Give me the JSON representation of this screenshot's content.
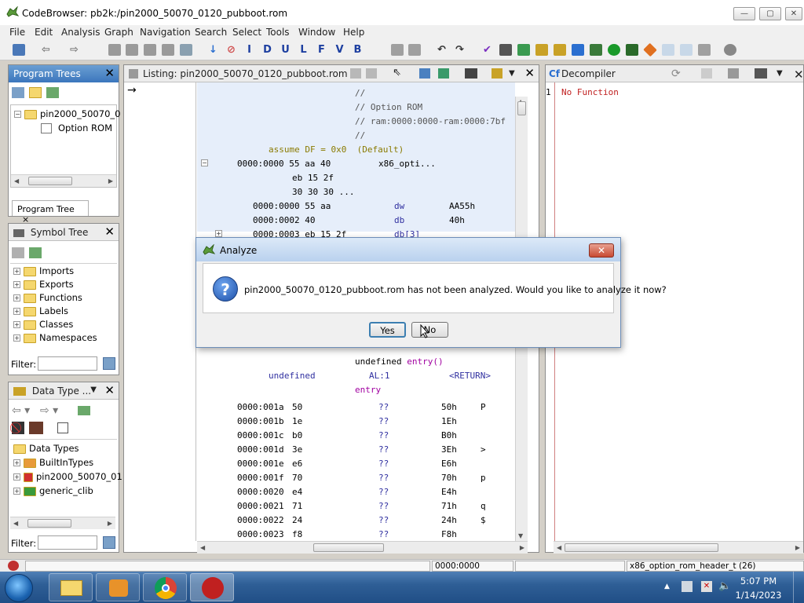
{
  "window": {
    "title": "CodeBrowser: pb2k:/pin2000_50070_0120_pubboot.rom",
    "min": "—",
    "max": "▢",
    "close": "✕"
  },
  "menu": [
    "File",
    "Edit",
    "Analysis",
    "Graph",
    "Navigation",
    "Search",
    "Select",
    "Tools",
    "Window",
    "Help"
  ],
  "toolbar": {
    "letters": [
      "I",
      "D",
      "U",
      "L",
      "F",
      "V",
      "B"
    ]
  },
  "program_trees": {
    "title": "Program Trees",
    "root": "pin2000_50070_0",
    "child": "Option ROM",
    "tab": "Program Tree",
    "tab_close": "×"
  },
  "symbol_tree": {
    "title": "Symbol Tree",
    "items": [
      "Imports",
      "Exports",
      "Functions",
      "Labels",
      "Classes",
      "Namespaces"
    ],
    "filter_label": "Filter:"
  },
  "data_type": {
    "title": "Data Type ...",
    "items": [
      "Data Types",
      "BuiltInTypes",
      "pin2000_50070_01",
      "generic_clib"
    ],
    "filter_label": "Filter:"
  },
  "listing": {
    "title": "Listing:  pin2000_50070_0120_pubboot.rom",
    "lines_top": [
      {
        "text": "//",
        "cls": "comment"
      },
      {
        "text": "// Option ROM",
        "cls": "comment"
      },
      {
        "text": "// ram:0000:0000-ram:0000:7bf",
        "cls": "comment"
      },
      {
        "text": "//",
        "cls": "comment"
      }
    ],
    "assume": "assume DF = 0x0  (Default)",
    "row0_addr": "0000:0000 55 aa 40",
    "row0_label": "x86_opti...",
    "row0_b2": "eb 15 2f",
    "row0_b3": "30 30 30 ...",
    "sub_rows": [
      {
        "addr": "0000:0000 55 aa",
        "mn": "dw",
        "op": "AA55h"
      },
      {
        "addr": "0000:0002 40",
        "mn": "db",
        "op": "40h"
      },
      {
        "addr": "0000:0003 eb 15 2f",
        "mn": "db[3]",
        "op": ""
      }
    ],
    "func_sig_pre": "undefined ",
    "func_sig_name": "entry()",
    "ret_type": "undefined",
    "ret_reg": "AL:1",
    "ret_ann": "<RETURN>",
    "entry_label": "entry",
    "data_rows": [
      {
        "a": "0000:001a",
        "b": "50",
        "q": "??",
        "v": "50h",
        "c": "P"
      },
      {
        "a": "0000:001b",
        "b": "1e",
        "q": "??",
        "v": "1Eh",
        "c": ""
      },
      {
        "a": "0000:001c",
        "b": "b0",
        "q": "??",
        "v": "B0h",
        "c": ""
      },
      {
        "a": "0000:001d",
        "b": "3e",
        "q": "??",
        "v": "3Eh",
        "c": ">"
      },
      {
        "a": "0000:001e",
        "b": "e6",
        "q": "??",
        "v": "E6h",
        "c": ""
      },
      {
        "a": "0000:001f",
        "b": "70",
        "q": "??",
        "v": "70h",
        "c": "p"
      },
      {
        "a": "0000:0020",
        "b": "e4",
        "q": "??",
        "v": "E4h",
        "c": ""
      },
      {
        "a": "0000:0021",
        "b": "71",
        "q": "??",
        "v": "71h",
        "c": "q"
      },
      {
        "a": "0000:0022",
        "b": "24",
        "q": "??",
        "v": "24h",
        "c": "$"
      },
      {
        "a": "0000:0023",
        "b": "f8",
        "q": "??",
        "v": "F8h",
        "c": ""
      }
    ]
  },
  "decompiler": {
    "title": "Decompiler",
    "line_no": "1",
    "text": "No Function"
  },
  "dialog": {
    "title": "Analyze",
    "message": "pin2000_50070_0120_pubboot.rom has not been analyzed. Would you like to analyze it now?",
    "yes": "Yes",
    "no": "No",
    "close": "✕"
  },
  "status": {
    "address": "0000:0000",
    "type": "x86_option_rom_header_t (26)"
  },
  "clock": {
    "time": "5:07 PM",
    "date": "1/14/2023"
  },
  "colors": {
    "accent": "#3b76bd",
    "taskbar": "#2f5f96"
  }
}
